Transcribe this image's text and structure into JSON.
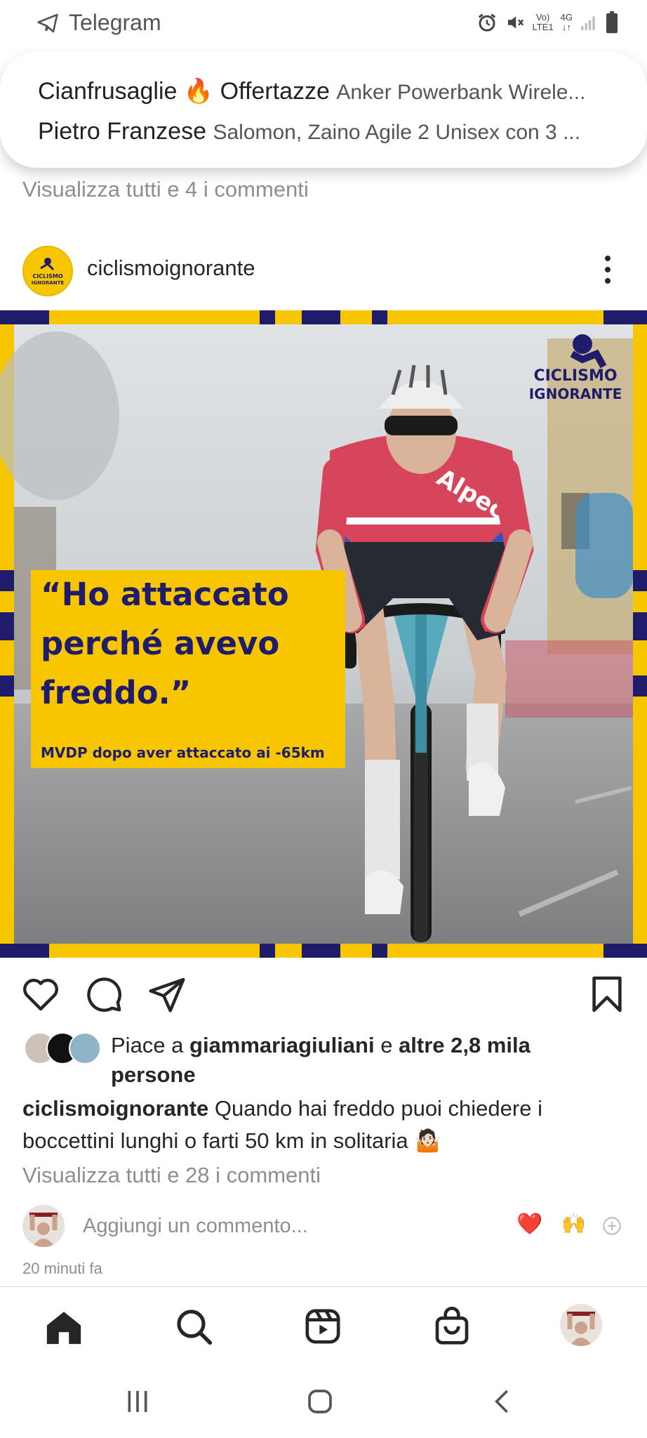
{
  "status_bar": {
    "app_name": "Telegram",
    "net_label_top": "Vo)",
    "net_label_bottom": "LTE1",
    "signal_label_top": "4G"
  },
  "notification": {
    "items": [
      {
        "sender": "Cianfrusaglie 🔥 Offertazze",
        "message": "Anker Powerbank Wirele..."
      },
      {
        "sender": "Pietro Franzese",
        "message": "Salomon, Zaino Agile 2 Unisex con 3 ..."
      }
    ]
  },
  "previous_post": {
    "view_comments": "Visualizza tutti e 4 i commenti"
  },
  "post": {
    "username": "ciclismoignorante",
    "image": {
      "quote_line1": "“Ho attaccato",
      "quote_line2": "perché avevo",
      "quote_line3": "freddo.”",
      "subline": "MVDP dopo aver attaccato ai -65km",
      "logo_line1": "CICLISMO",
      "logo_line2": "IGNORANTE",
      "avatar_logo_top": "CICLISMO",
      "avatar_logo_bottom": "IGNORANTE",
      "jersey_text": "Alpecin"
    },
    "likes": {
      "prefix": "Piace a ",
      "user": "giammariagiuliani",
      "mid": " e ",
      "others": "altre 2,8 mila persone"
    },
    "caption": {
      "username": "ciclismoignorante",
      "text": " Quando hai freddo puoi chiedere i boccettini lunghi o farti 50 km in solitaria 🤷🏻"
    },
    "view_comments": "Visualizza tutti e 28 i commenti",
    "add_comment_placeholder": "Aggiungi un commento...",
    "quick_reactions": [
      "❤️",
      "🙌"
    ],
    "timestamp": "20 minuti fa"
  },
  "bottom_nav": [
    "home",
    "search",
    "reels",
    "shop",
    "profile"
  ],
  "colors": {
    "brand_yellow": "#f7c600",
    "brand_navy": "#1e1c6b",
    "heart_red": "#ed1c24",
    "muted": "#8e8e8e"
  }
}
